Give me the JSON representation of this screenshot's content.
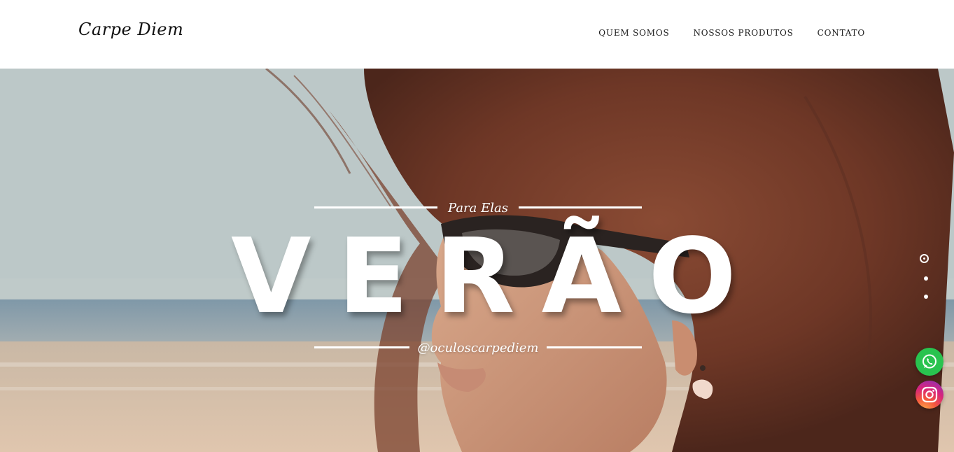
{
  "header": {
    "logo_text": "Carpe Diem",
    "nav": [
      {
        "label": "QUEM SOMOS"
      },
      {
        "label": "NOSSOS PRODUTOS"
      },
      {
        "label": "CONTATO"
      }
    ]
  },
  "hero": {
    "tagline": "Para Elas",
    "headline": "VERÃO",
    "handle": "@oculoscarpediem",
    "slider": {
      "slides": 3,
      "active": 1
    }
  },
  "floating": {
    "whatsapp": {
      "icon": "whatsapp-icon",
      "color": "#29c34f"
    },
    "instagram": {
      "icon": "instagram-icon",
      "color": "#e1306c"
    }
  },
  "colors": {
    "text_dark": "#1a1a1a",
    "hero_text": "#ffffff"
  }
}
